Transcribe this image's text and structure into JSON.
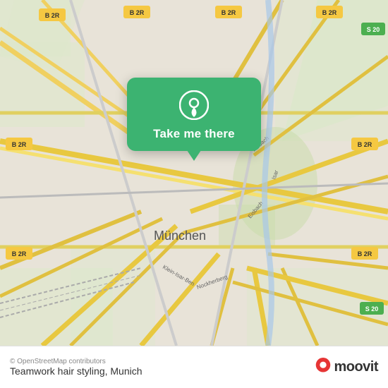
{
  "map": {
    "alt": "Map of Munich area",
    "attribution": "© OpenStreetMap contributors",
    "popup": {
      "button_label": "Take me there"
    }
  },
  "bottom_bar": {
    "copyright": "© OpenStreetMap contributors",
    "location_name": "Teamwork hair styling, Munich",
    "logo_text": "moovit"
  },
  "colors": {
    "popup_bg": "#3cb371",
    "bottom_bar_bg": "#ffffff"
  }
}
